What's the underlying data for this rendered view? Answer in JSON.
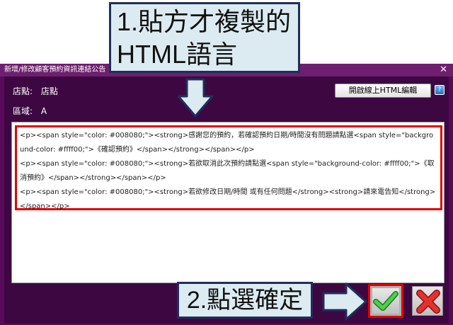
{
  "dialog": {
    "title": "新增/修改顧客預約資訊連結公告",
    "close_glyph": "✕",
    "store_label": "店點:",
    "store_value": "店點",
    "area_label": "區域:",
    "area_value": "A",
    "open_editor_label": "開啟線上HTML編輯",
    "help_glyph": "?"
  },
  "code": {
    "lines": [
      "<p><span style=\"color: #008080;\"><strong>感謝您的預約，若確認預約日期/時間沒有問題請點選<span style=\"background-color: #ffff00;\">《確認預約》</span></strong></span></p>",
      "<p><span style=\"color: #008080;\"><strong>若欲取消此次預約請點選<span style=\"background-color: #ffff00;\">《取消預約》</span></strong></span></p>",
      "<p><span style=\"color: #008080;\"><strong>若欲修改日期/時間 或有任何問題</strong><strong>請來電告知</strong></span></p>"
    ]
  },
  "callouts": {
    "step1_line1": "1.貼方才複製的",
    "step1_line2": "HTML語言",
    "step2": "2.點選確定"
  },
  "colors": {
    "dialog_bg": "#5a0a5a",
    "titlebar_bg": "#6e1f6e",
    "highlight_red": "#e00000",
    "callout_fill": "#dcebf2",
    "arrow_fill": "#dcebf2",
    "arrow_stroke": "#1f2f5a",
    "check_green": "#2fa82f",
    "cross_red": "#d62020"
  }
}
